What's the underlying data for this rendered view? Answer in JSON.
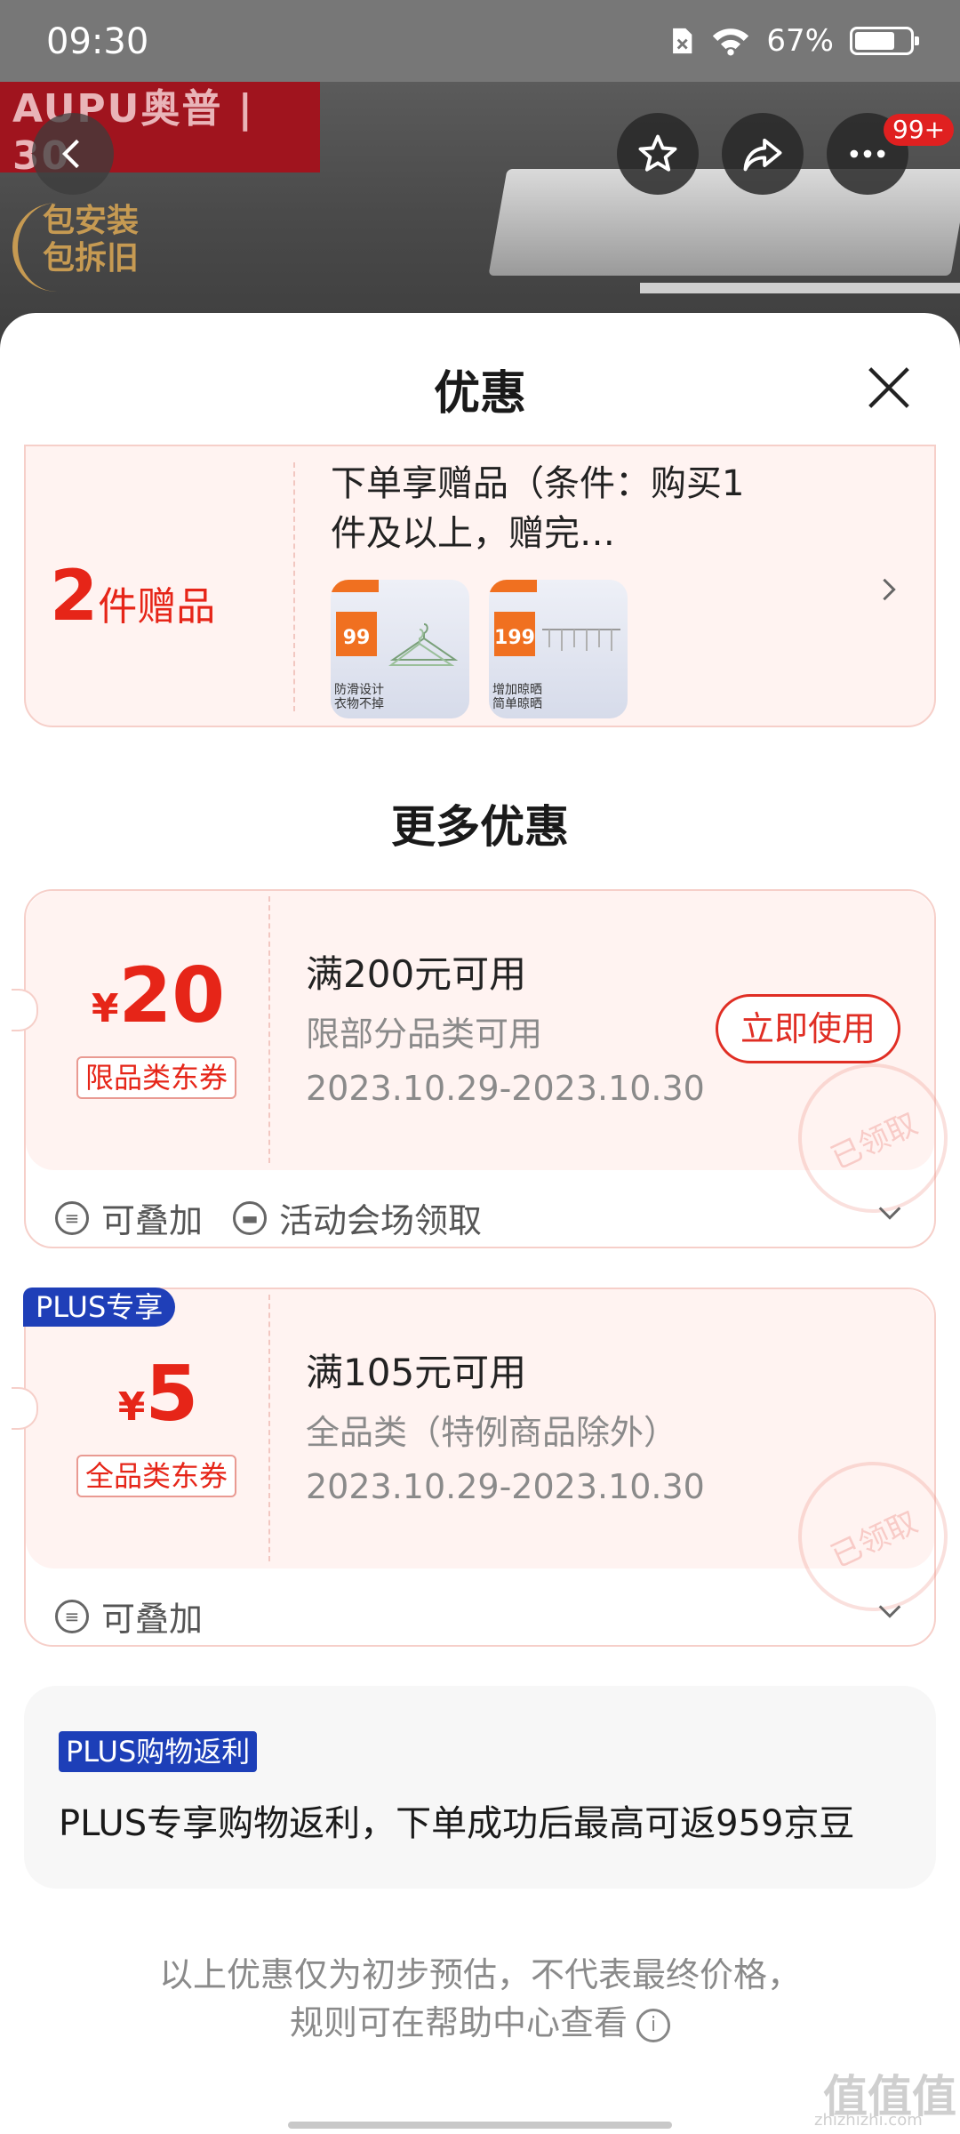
{
  "status": {
    "time": "09:30",
    "battery": "67%"
  },
  "banner": {
    "brand": "AUPU奥普 | 30",
    "install_line1": "包安装",
    "install_line2": "包拆旧",
    "more_badge": "99+"
  },
  "sheet": {
    "title": "优惠"
  },
  "gift": {
    "count": "2",
    "unit": "件赠品",
    "text": "下单享赠品（条件：购买1件及以上，赠完…",
    "thumbs": [
      {
        "price": "99",
        "caption": "防滑设计 衣物不掉"
      },
      {
        "price": "199",
        "caption": "增加晾晒 简单晾晒"
      }
    ]
  },
  "more_title": "更多优惠",
  "coupons": [
    {
      "currency": "¥",
      "amount": "20",
      "tag": "限品类东券",
      "condition": "满200元可用",
      "scope": "限部分品类可用",
      "dates": "2023.10.29-2023.10.30",
      "button": "立即使用",
      "stamp": "已领取",
      "foot1": "可叠加",
      "foot2": "活动会场领取"
    },
    {
      "plus_badge": "PLUS专享",
      "currency": "¥",
      "amount": "5",
      "tag": "全品类东券",
      "condition": "满105元可用",
      "scope": "全品类（特例商品除外）",
      "dates": "2023.10.29-2023.10.30",
      "stamp": "已领取",
      "foot1": "可叠加"
    }
  ],
  "rebate": {
    "tag": "PLUS购物返利",
    "text": "PLUS专享购物返利，下单成功后最高可返959京豆"
  },
  "note": {
    "line1": "以上优惠仅为初步预估，不代表最终价格，",
    "line2": "规则可在帮助中心查看"
  },
  "watermark": {
    "main": "值值值",
    "sub": "zhizhizhi.com"
  }
}
